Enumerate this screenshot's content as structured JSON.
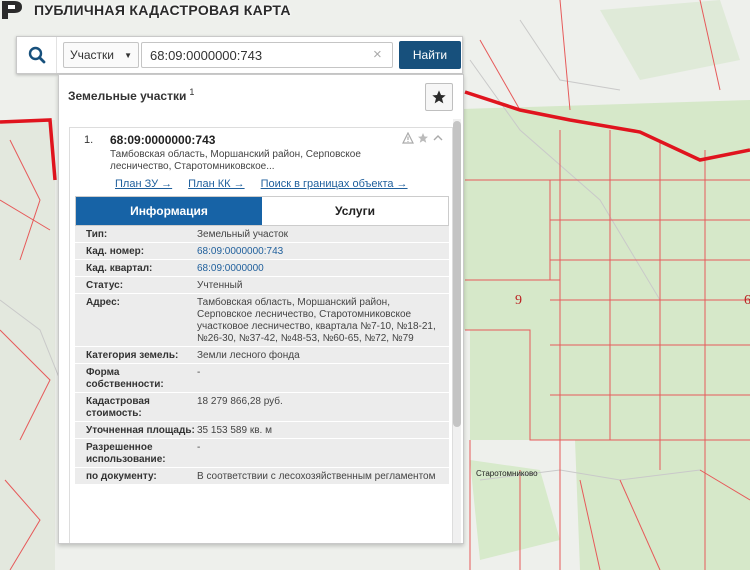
{
  "app": {
    "title": "ПУБЛИЧНАЯ КАДАСТРОВАЯ КАРТА"
  },
  "search": {
    "type_selected": "Участки",
    "query": "68:09:0000000:743",
    "find_label": "Найти"
  },
  "panel": {
    "title": "Земельные участки",
    "count": "1"
  },
  "result": {
    "number": "1.",
    "cad_number": "68:09:0000000:743",
    "address_short": "Тамбовская область, Моршанский район, Серповское лесничество, Старотомниковское...",
    "links": [
      "План ЗУ →",
      "План КК →",
      "Поиск в границах объекта →"
    ],
    "tabs": [
      "Информация",
      "Услуги"
    ],
    "info": [
      {
        "key": "Тип:",
        "value": "Земельный участок"
      },
      {
        "key": "Кад. номер:",
        "value": "68:09:0000000:743"
      },
      {
        "key": "Кад. квартал:",
        "value": "68:09:0000000"
      },
      {
        "key": "Статус:",
        "value": "Учтенный"
      },
      {
        "key": "Адрес:",
        "value": "Тамбовская область, Моршанский район, Серповское лесничество, Старотомниковское участковое лесничество, квартала №7-10, №18-21, №26-30, №37-42, №48-53, №60-65, №72, №79"
      },
      {
        "key": "Категория земель:",
        "value": "Земли лесного фонда"
      },
      {
        "key": "Форма собственности:",
        "value": "-"
      },
      {
        "key": "Кадастровая стоимость:",
        "value": "18 279 866,28 руб."
      },
      {
        "key": "Уточненная площадь:",
        "value": "35 153 589 кв. м"
      },
      {
        "key": "Разрешенное использование:",
        "value": "-"
      },
      {
        "key": "по документу:",
        "value": "В соответствии с лесохозяйственным регламентом"
      }
    ]
  },
  "map": {
    "labels": {
      "block_9": "9",
      "block_edge": "6",
      "town": "Старотомниково"
    }
  },
  "colors": {
    "accent": "#17507c",
    "tab_active": "#1763a6",
    "boundary": "#e0141e",
    "parcel_line": "#e65a5a",
    "forest": "#cfe6c1",
    "link": "#1f5f9c"
  },
  "icons": [
    "search-icon",
    "chevron-down-icon",
    "clear-icon",
    "star-icon",
    "warning-icon",
    "collapse-icon",
    "logo-icon"
  ]
}
